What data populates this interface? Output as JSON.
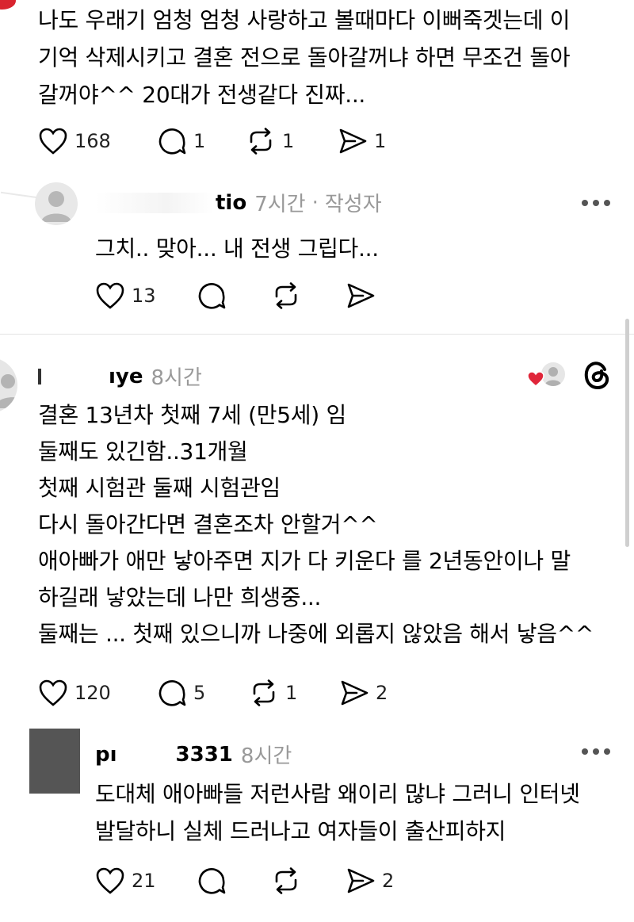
{
  "post1": {
    "lines": [
      "나도 우래기 엄청 엄청 사랑하고 볼때마다 이뻐죽겟는데 이",
      "기억 삭제시키고 결혼 전으로 돌아갈꺼냐 하면 무조건 돌아",
      "갈꺼야^^ 20대가 전생같다 진짜..."
    ],
    "likes": "168",
    "replies": "1",
    "reposts": "1",
    "shares": "1"
  },
  "reply1": {
    "username": "tio",
    "time": "7시간",
    "separator": "·",
    "author_tag": "작성자",
    "text": "그치.. 맞아... 내 전생 그립다...",
    "likes": "13"
  },
  "post2": {
    "username": "ıye",
    "time": "8시간",
    "lines": [
      "결혼 13년차 첫째 7세 (만5세) 임",
      "둘째도 있긴함..31개월",
      "첫째 시험관 둘째 시험관임",
      "다시 돌아간다면 결혼조차 안할거^^",
      "애아빠가 애만 낳아주면 지가 다 키운다 를 2년동안이나 말",
      "하길래 낳았는데 나만 희생중...",
      "둘째는 ... 첫째 있으니까 나중에 외롭지 않았음 해서 낳음^^"
    ],
    "likes": "120",
    "replies": "5",
    "reposts": "1",
    "shares": "2"
  },
  "reply2": {
    "username_prefix": "pı",
    "username_suffix": "3331",
    "time": "8시간",
    "lines": [
      "도대체 애아빠들 저런사람 왜이리 많냐 그러니 인터넷",
      "발달하니 실체 드러나고 여자들이 출산피하지"
    ],
    "likes": "21",
    "shares": "2"
  },
  "colors": {
    "heart_red": "#e0263a",
    "gray_text": "#999999"
  }
}
